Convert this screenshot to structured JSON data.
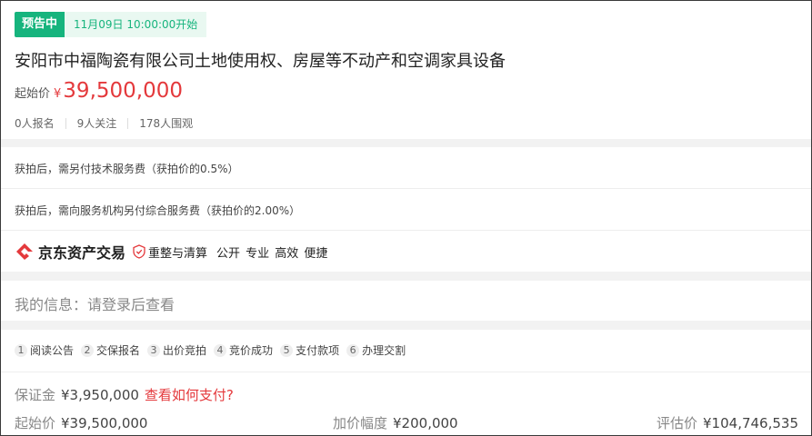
{
  "header": {
    "status_badge": "预告中",
    "start_time": "11月09日 10:00:00开始"
  },
  "item": {
    "title": "安阳市中福陶瓷有限公司土地使用权、房屋等不动产和空调家具设备",
    "start_price_label": "起始价",
    "currency": "¥",
    "start_price": "39,500,000"
  },
  "stats": [
    "0人报名",
    "9人关注",
    "178人围观"
  ],
  "fees": [
    "获拍后，需另付技术服务费（获拍价的0.5%）",
    "获拍后，需向服务机构另付综合服务费（获拍价的2.00%）"
  ],
  "brand": {
    "name": "京东资产交易",
    "tag": "重整与清算",
    "slogan": "公开 专业 高效 便捷"
  },
  "my_info": "我的信息：请登录后查看",
  "steps": [
    {
      "num": "1",
      "label": "阅读公告"
    },
    {
      "num": "2",
      "label": "交保报名"
    },
    {
      "num": "3",
      "label": "出价竞拍"
    },
    {
      "num": "4",
      "label": "竞价成功"
    },
    {
      "num": "5",
      "label": "支付款项"
    },
    {
      "num": "6",
      "label": "办理交割"
    }
  ],
  "deposit": {
    "label": "保证金",
    "value": "¥3,950,000",
    "link": "查看如何支付?"
  },
  "bottom": {
    "start_price_label": "起始价",
    "start_price_value": "¥39,500,000",
    "increment_label": "加价幅度",
    "increment_value": "¥200,000",
    "appraisal_label": "评估价",
    "appraisal_value": "¥104,746,535"
  },
  "colors": {
    "accent_green": "#16b47d",
    "price_red": "#e4393c"
  },
  "icons": {
    "brand_logo": "jd-asset-logo-icon",
    "shield": "shield-check-icon"
  }
}
